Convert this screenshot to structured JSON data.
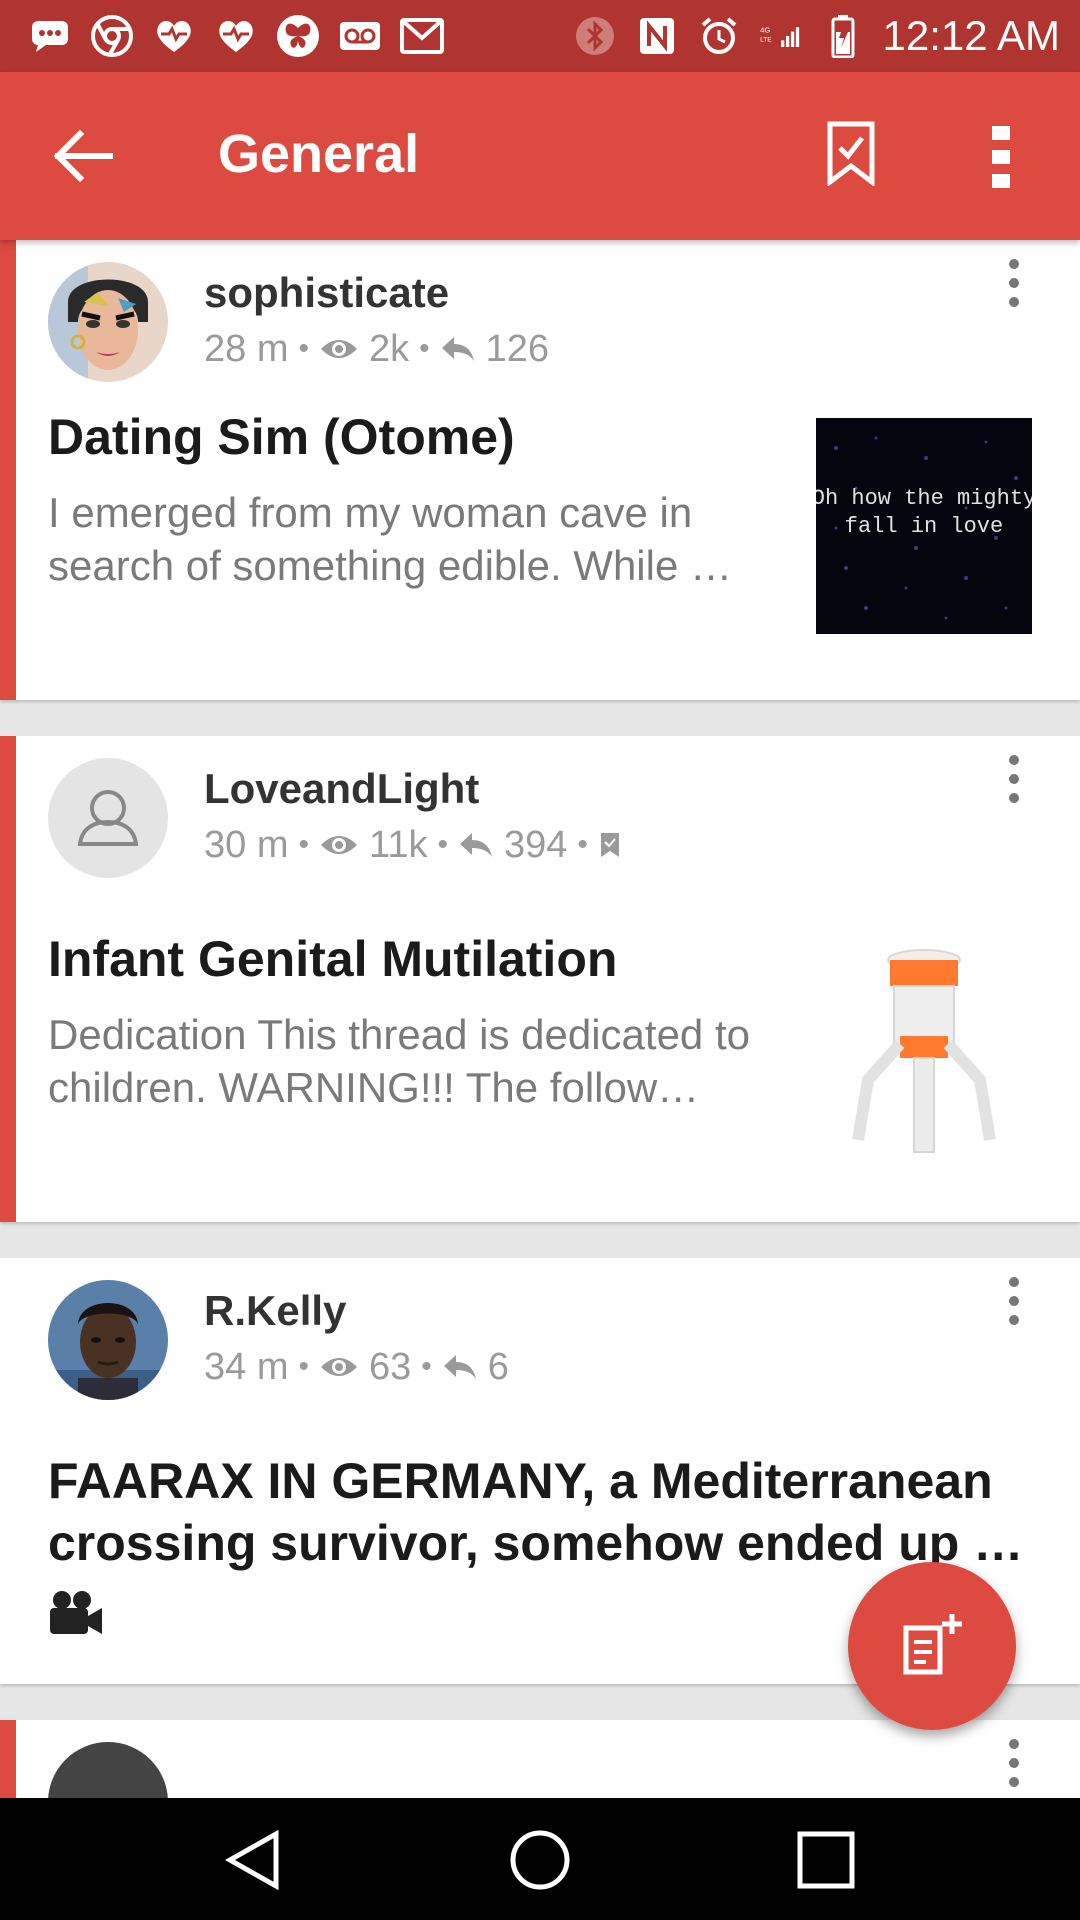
{
  "status_bar": {
    "time": "12:12 AM",
    "left_icons": [
      "chat-bubble-icon",
      "chrome-icon",
      "heart-icon",
      "heart-icon",
      "butterfly-icon",
      "voicemail-icon",
      "gmail-icon"
    ],
    "right_icons": [
      "bluetooth-icon",
      "nfc-icon",
      "alarm-icon",
      "lte-signal-icon",
      "battery-icon"
    ]
  },
  "app_bar": {
    "title": "General",
    "accent_color": "#dd4a3f"
  },
  "posts": [
    {
      "author": "sophisticate",
      "time": "28 m",
      "views": "2k",
      "replies": "126",
      "title": "Dating Sim (Otome)",
      "excerpt": "I emerged from my woman cave in search of something edible. While …",
      "thumb_text": [
        "Oh how the mighty",
        "fall in love"
      ],
      "unread": true
    },
    {
      "author": "LoveandLight",
      "time": "30 m",
      "views": "11k",
      "replies": "394",
      "bookmarked": true,
      "title": "Infant Genital Mutilation",
      "excerpt": "Dedication This thread is dedicated to children. WARNING!!! The follow…",
      "unread": true
    },
    {
      "author": "R.Kelly",
      "time": "34 m",
      "views": "63",
      "replies": "6",
      "title": "FAARAX IN GERMANY, a Mediterranean crossing survivor, somehow ended up …",
      "attachment": "video-camera-icon",
      "unread": false
    }
  ]
}
